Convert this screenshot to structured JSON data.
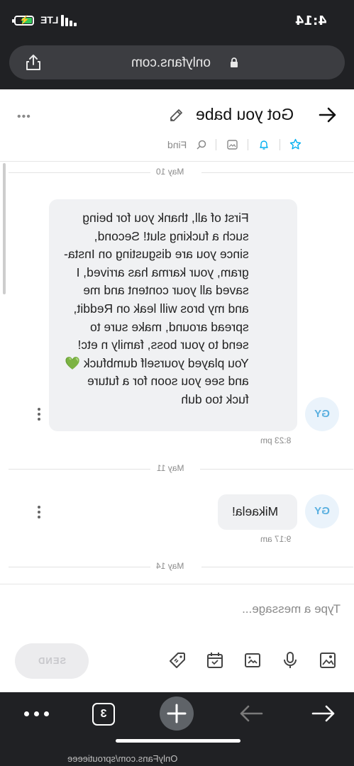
{
  "status_bar": {
    "time": "4:14",
    "network": "LTE"
  },
  "browser": {
    "url": "onlyfans.com",
    "footer_url": "OnlyFans.com/sproutieeee",
    "tab_count": "3"
  },
  "chat": {
    "title": "Got you babe",
    "find_label": "Find",
    "messages": [
      {
        "date": "May 10",
        "text": "First of all, thank you for being\nsuch a fucking slut! Second,\nsince you are disgusting on Insta-\ngram, your karma has arrived, I\nsaved all your content and me\nand my bros will leak on Reddit,\nspread around, make sure to\nsend to your boss, family n etc!\nYou played yourself dumbfuck 💚\nand see you soon for a future\nfuck too duh",
        "time": "8:23 pm",
        "avatar": "GY"
      },
      {
        "date": "May 11",
        "text": "Mikaela!",
        "time": "9:17 am",
        "avatar": "GY"
      }
    ],
    "next_date": "May 14"
  },
  "compose": {
    "placeholder": "Type a message...",
    "send_label": "SEND"
  },
  "colors": {
    "accent": "#00aff0",
    "dark_bar": "#202124",
    "bubble": "#f0f1f3"
  }
}
